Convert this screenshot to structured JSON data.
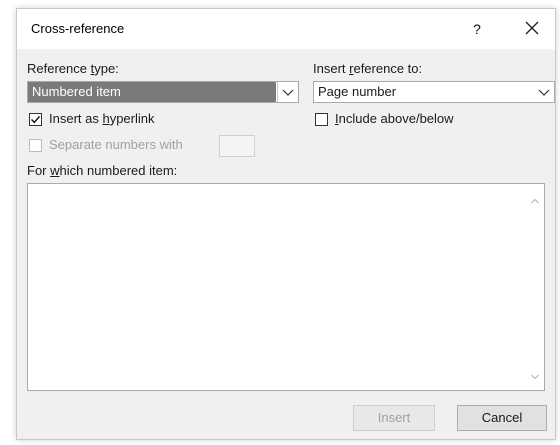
{
  "dialog": {
    "title": "Cross-reference",
    "help_glyph": "?"
  },
  "reference_type": {
    "label_pre": "Reference ",
    "label_hot": "t",
    "label_post": "ype:",
    "value": "Numbered item"
  },
  "insert_reference_to": {
    "label_pre": "Insert ",
    "label_hot": "r",
    "label_post": "eference to:",
    "value": "Page number"
  },
  "insert_as_hyperlink": {
    "label_pre": "Insert as ",
    "label_hot": "h",
    "label_post": "yperlink",
    "checked": true
  },
  "include_above_below": {
    "label_pre": "",
    "label_hot": "I",
    "label_post": "nclude above/below",
    "checked": false
  },
  "separate_numbers": {
    "label": "Separate numbers with",
    "checked": false,
    "enabled": false
  },
  "which_item": {
    "label_pre": "For ",
    "label_hot": "w",
    "label_post": "hich numbered item:"
  },
  "buttons": {
    "insert": "Insert",
    "cancel": "Cancel"
  },
  "colors": {
    "selection": "#7a7a7a",
    "dialog_bg": "#f0f0f0"
  }
}
